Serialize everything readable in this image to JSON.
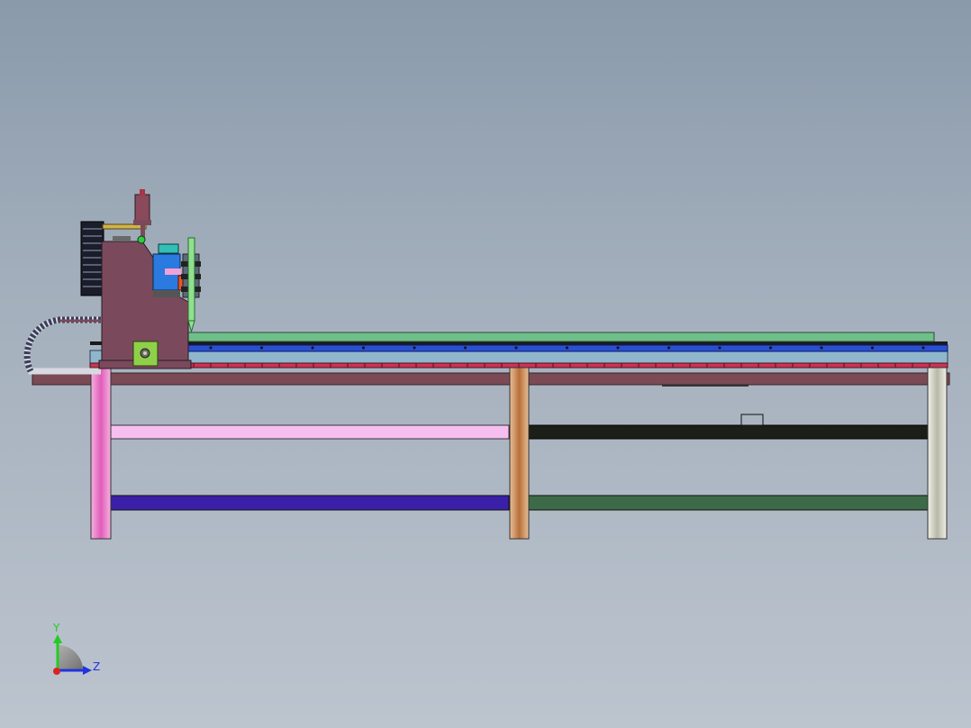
{
  "view": {
    "background_top": "#8a9aab",
    "background_bottom": "#bcc4ce"
  },
  "triad": {
    "y_label": "Y",
    "z_label": "Z",
    "y_color": "#22cc22",
    "z_color": "#2233dd",
    "x_color": "#dd2222"
  },
  "colors": {
    "gantry": "#7a4a5c",
    "rail_green": "#6fbf8a",
    "rail_blue": "#2a4fd0",
    "rail_lightblue": "#8fb6cc",
    "rail_red": "#cc3355",
    "table_top": "#7a4b55",
    "leg_pink": "#e77bc6",
    "leg_copper": "#c8895a",
    "leg_silver": "#d4d4c8",
    "beam_pink": "#f7bff0",
    "beam_black": "#1c1f18",
    "beam_purple": "#3a1fa8",
    "beam_green": "#3e6b47",
    "motor_blue": "#2a7ae0",
    "cable_chain": "#3a3f5a",
    "torch_green": "#8fe08f"
  }
}
